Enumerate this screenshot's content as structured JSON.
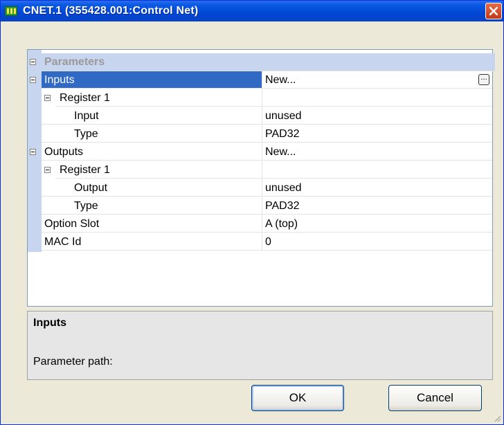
{
  "window": {
    "title": "CNET.1 (355428.001:Control Net)"
  },
  "grid": {
    "category": "Parameters",
    "rows": [
      {
        "name": "Inputs",
        "value": "New..."
      },
      {
        "name": "Register 1",
        "value": ""
      },
      {
        "name": "Input",
        "value": "unused"
      },
      {
        "name": "Type",
        "value": "PAD32"
      },
      {
        "name": "Outputs",
        "value": "New..."
      },
      {
        "name": "Register 1",
        "value": ""
      },
      {
        "name": "Output",
        "value": "unused"
      },
      {
        "name": "Type",
        "value": "PAD32"
      },
      {
        "name": "Option Slot",
        "value": "A (top)"
      },
      {
        "name": "MAC Id",
        "value": "0"
      }
    ],
    "ellipsis": "..."
  },
  "description": {
    "title": "Inputs",
    "path_label": "Parameter path:"
  },
  "buttons": {
    "ok": "OK",
    "cancel": "Cancel"
  },
  "colors": {
    "titlebar": "#0a5ae4",
    "selection": "#316ac5",
    "gutter": "#c8d5ee"
  },
  "icons": {
    "app": "app-icon",
    "close": "close-icon",
    "ellipsis": "ellipsis-icon",
    "collapse": "collapse-toggle-icon"
  }
}
